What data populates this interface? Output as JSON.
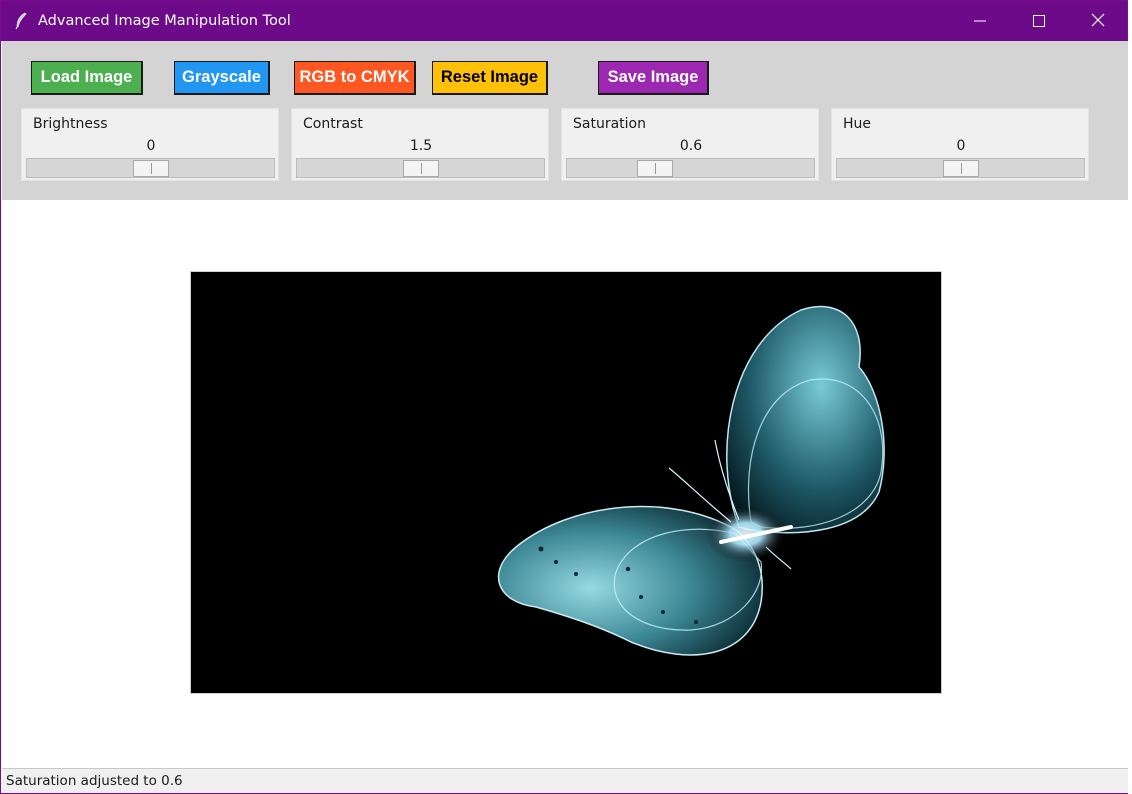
{
  "window": {
    "title": "Advanced Image Manipulation Tool",
    "titlebar_color": "#6d0a8a"
  },
  "toolbar": {
    "buttons": [
      {
        "label": "Load Image",
        "color": "#4caf50"
      },
      {
        "label": "Grayscale",
        "color": "#2196f3"
      },
      {
        "label": "RGB to CMYK",
        "color": "#ff5722"
      },
      {
        "label": "Reset Image",
        "color": "#ffc107"
      },
      {
        "label": "Save Image",
        "color": "#9c27b0"
      }
    ]
  },
  "sliders": [
    {
      "label": "Brightness",
      "value": "0",
      "level": 0.5
    },
    {
      "label": "Contrast",
      "value": "1.5",
      "level": 0.5
    },
    {
      "label": "Saturation",
      "value": "0.6",
      "level": 0.33
    },
    {
      "label": "Hue",
      "value": "0",
      "level": 0.5
    }
  ],
  "image": {
    "subject": "glowing cyan butterfly on black background"
  },
  "status": {
    "text": "Saturation adjusted to 0.6"
  },
  "icons": {
    "app": "feather-icon",
    "minimize": "minimize-icon",
    "maximize": "maximize-icon",
    "close": "close-icon"
  }
}
